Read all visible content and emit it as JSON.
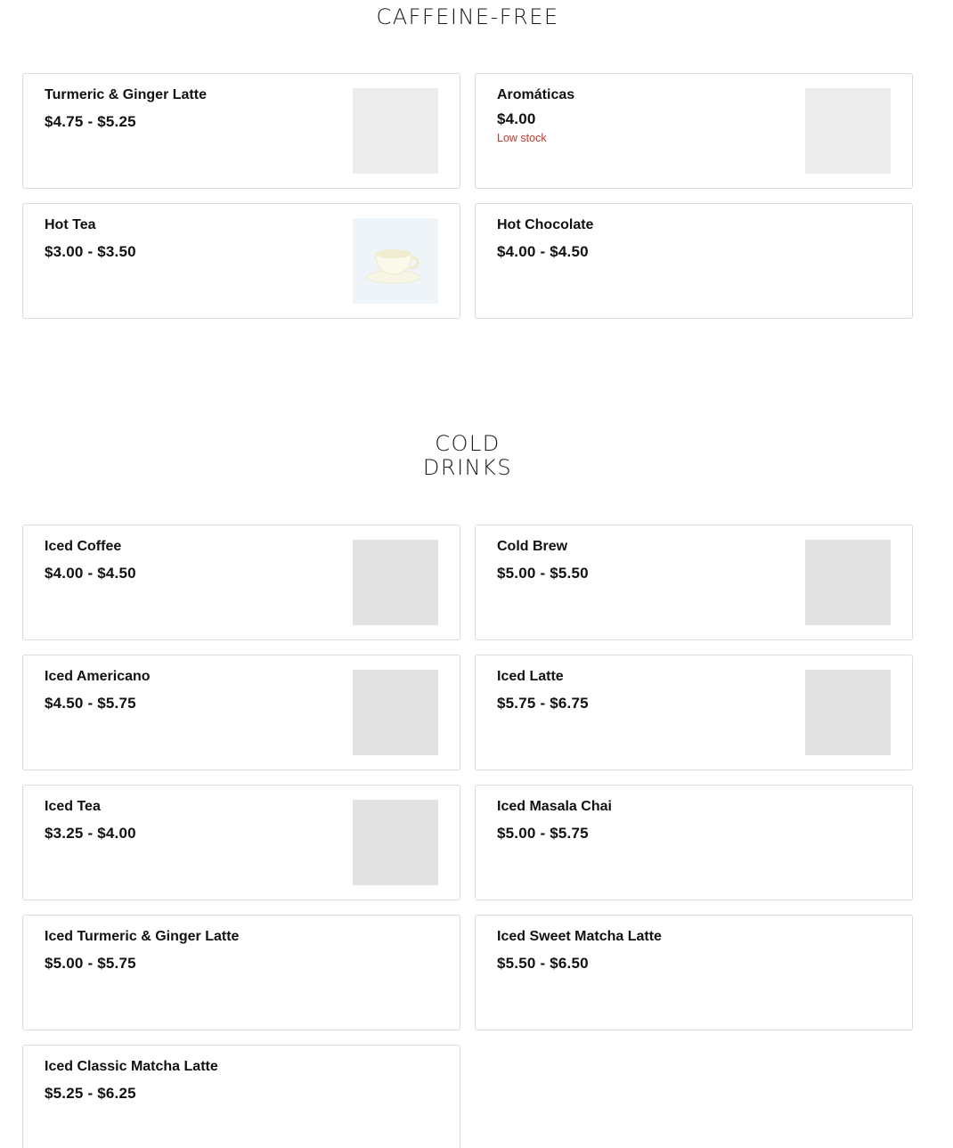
{
  "sections": {
    "caffeine_free": {
      "title": "CAFFEINE-FREE",
      "items": [
        {
          "name": "Turmeric & Ginger Latte",
          "price": "$4.75 - $5.25",
          "image": "placeholder"
        },
        {
          "name": "Aromáticas",
          "price": "$4.00",
          "status": "Low stock",
          "image": "placeholder"
        },
        {
          "name": "Hot Tea",
          "price": "$3.00 - $3.50",
          "image": "tea-cup-photo"
        },
        {
          "name": "Hot Chocolate",
          "price": "$4.00 - $4.50",
          "image": "none"
        }
      ]
    },
    "cold_drinks": {
      "title_line1": "COLD",
      "title_line2": "DRINKS",
      "items": [
        {
          "name": "Iced Coffee",
          "price": "$4.00 - $4.50",
          "image": "placeholder"
        },
        {
          "name": "Cold Brew",
          "price": "$5.00 - $5.50",
          "image": "placeholder"
        },
        {
          "name": "Iced Americano",
          "price": "$4.50 - $5.75",
          "image": "placeholder"
        },
        {
          "name": "Iced Latte",
          "price": "$5.75 - $6.75",
          "image": "placeholder"
        },
        {
          "name": "Iced Tea",
          "price": "$3.25 - $4.00",
          "image": "placeholder"
        },
        {
          "name": "Iced Masala Chai",
          "price": "$5.00 - $5.75",
          "image": "none"
        },
        {
          "name": "Iced Turmeric & Ginger Latte",
          "price": "$5.00 - $5.75",
          "image": "none"
        },
        {
          "name": "Iced Sweet Matcha Latte",
          "price": "$5.50 - $6.50",
          "image": "none"
        },
        {
          "name": "Iced Classic Matcha Latte",
          "price": "$5.25 - $6.25",
          "image": "none"
        }
      ]
    }
  },
  "colors": {
    "low_stock": "#c0392b",
    "card_border": "#dcdcdc",
    "image_placeholder": "#e1e1e1"
  }
}
